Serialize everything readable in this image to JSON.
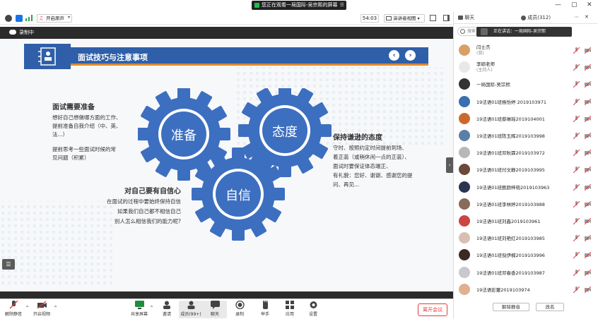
{
  "share_banner": {
    "text": "您正在观看一局国际-吴宗熙的屏幕"
  },
  "toolbar": {
    "sound_label": "开启原声",
    "timer": "54:03",
    "view_label": "演讲者视图"
  },
  "recording": {
    "label": "录制中"
  },
  "slide": {
    "title": "面试技巧与注意事项",
    "gears": [
      "准备",
      "态度",
      "自信"
    ],
    "prep_heading": "面试需要准备",
    "prep_lines": [
      "想好自己想做哪方面的工作、",
      "提前准备自我介绍（中、英、",
      "法...）"
    ],
    "prep_lines2": [
      "提前思考一些面试时候的常",
      "见问题（积累）"
    ],
    "attitude_heading": "保持谦逊的态度",
    "attitude_lines": [
      "守时、按照约定时间提前到场、",
      "着正装（或稍休闲一点的正装）、",
      "面试时要保证体态端正、",
      "有礼貌：您好、谢谢、感谢您的提",
      "问、再见..."
    ],
    "confidence_heading": "对自己要有自信心",
    "confidence_lines": [
      "在面试的过程中要始终保持自信",
      "如果我们自己都不相信自己",
      "别人怎么相信我们的能力呢?"
    ]
  },
  "bottombar": {
    "unmute": "解除静音",
    "video": "开启视频",
    "share": "共享屏幕",
    "invite": "邀请",
    "members": "成员(99+)",
    "chat": "聊天",
    "record": "录制",
    "raise_hand": "举手",
    "apps": "应用",
    "settings": "设置",
    "leave": "离开会议"
  },
  "panel": {
    "chat_tab": "聊天",
    "members_tab": "成员(312)",
    "search_placeholder": "搜索",
    "speaker_text": "正在讲话：一局国际-吴宗熙",
    "unmute_all": "解除静音",
    "rename": "改名",
    "members": [
      {
        "name": "闫士杰",
        "role": "(我)",
        "avatar_color": "#d9a066"
      },
      {
        "name": "李硕老师",
        "role": "(主持人)",
        "avatar_color": "#e8e8e8"
      },
      {
        "name": "一局国际-吴宗熙",
        "role": "",
        "avatar_color": "#333333"
      },
      {
        "name": "19法语01班杨怡婷 2019103971",
        "role": "",
        "avatar_color": "#3a6fb0"
      },
      {
        "name": "19法语01班蔡琳瑶2019104001",
        "role": "",
        "avatar_color": "#c96a2c"
      },
      {
        "name": "19法语01班陈玉辉2019103998",
        "role": "",
        "avatar_color": "#5a7fa8"
      },
      {
        "name": "19法语01班邓秋霖2019103972",
        "role": "",
        "avatar_color": "#b8b8b8"
      },
      {
        "name": "19法语01班付文静2019103995",
        "role": "",
        "avatar_color": "#6b4a3a"
      },
      {
        "name": "19法语01班鲍颜梓萌2019103963",
        "role": "",
        "avatar_color": "#2a3550"
      },
      {
        "name": "19法语01班李林婷2019103988",
        "role": "",
        "avatar_color": "#8a6a5a"
      },
      {
        "name": "19法语01班刘鑫2019103961",
        "role": "",
        "avatar_color": "#c44"
      },
      {
        "name": "19法语01班刘艳红2019103985",
        "role": "",
        "avatar_color": "#d8c0b0"
      },
      {
        "name": "19法语01班倪伊楠2019103996",
        "role": "",
        "avatar_color": "#3a2a22"
      },
      {
        "name": "19法语01班邓春香2019103987",
        "role": "",
        "avatar_color": "#c8c8d0"
      },
      {
        "name": "19法语彭蕾2019103974",
        "role": "",
        "avatar_color": "#e0b090"
      }
    ]
  }
}
